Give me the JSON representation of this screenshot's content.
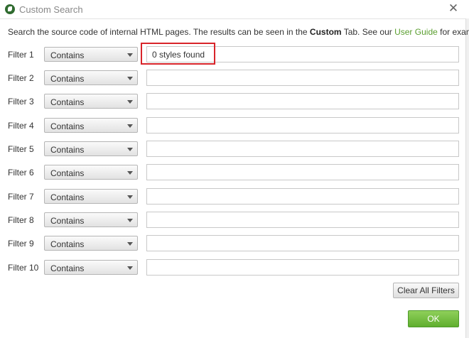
{
  "window": {
    "title": "Custom Search"
  },
  "intro": {
    "part1": "Search the source code of internal HTML pages. The results can be seen in the ",
    "bold": "Custom",
    "part2": " Tab. See our ",
    "link": "User Guide",
    "part3": " for examples."
  },
  "filters": [
    {
      "label": "Filter 1",
      "mode": "Contains",
      "value": "0 styles found"
    },
    {
      "label": "Filter 2",
      "mode": "Contains",
      "value": ""
    },
    {
      "label": "Filter 3",
      "mode": "Contains",
      "value": ""
    },
    {
      "label": "Filter 4",
      "mode": "Contains",
      "value": ""
    },
    {
      "label": "Filter 5",
      "mode": "Contains",
      "value": ""
    },
    {
      "label": "Filter 6",
      "mode": "Contains",
      "value": ""
    },
    {
      "label": "Filter 7",
      "mode": "Contains",
      "value": ""
    },
    {
      "label": "Filter 8",
      "mode": "Contains",
      "value": ""
    },
    {
      "label": "Filter 9",
      "mode": "Contains",
      "value": ""
    },
    {
      "label": "Filter 10",
      "mode": "Contains",
      "value": ""
    }
  ],
  "buttons": {
    "clear_all": "Clear All Filters",
    "ok": "OK"
  },
  "colors": {
    "link": "#5a9e2f",
    "ok_button": "#6cb83a",
    "highlight": "#d8242a"
  }
}
